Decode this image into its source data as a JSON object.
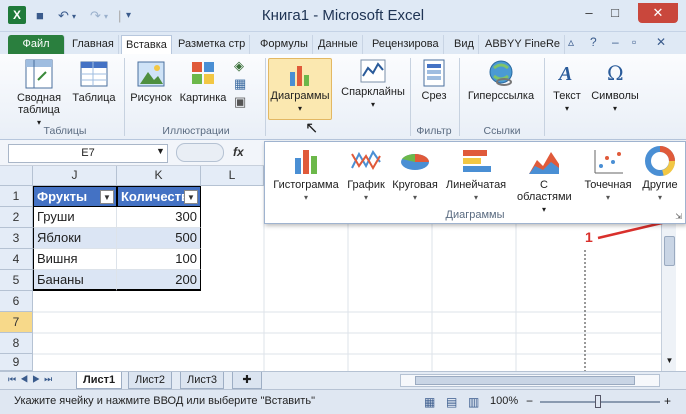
{
  "window": {
    "title": "Книга1  -  Microsoft Excel"
  },
  "tabs": [
    "Файл",
    "Главная",
    "Вставка",
    "Разметка стр",
    "Формулы",
    "Данные",
    "Рецензирова",
    "Вид",
    "ABBYY FineRe"
  ],
  "ribbon": {
    "tables": {
      "pivot": "Сводная\nтаблица",
      "pivot_arrow": "▾",
      "table": "Таблица",
      "group": "Таблицы"
    },
    "illustrations": {
      "picture": "Рисунок",
      "clipart": "Картинка",
      "group": "Иллюстрации"
    },
    "charts": {
      "label": "Диаграммы"
    },
    "sparklines": {
      "label": "Спарклайны"
    },
    "filter": {
      "slicer": "Срез",
      "group": "Фильтр"
    },
    "links": {
      "hyperlink": "Гиперссылка",
      "group": "Ссылки"
    },
    "text": {
      "label": "Текст"
    },
    "symbols": {
      "label": "Символы"
    }
  },
  "formula_bar": {
    "name_box": "E7",
    "fx": "fx"
  },
  "chart_dropdown": {
    "items": [
      "Гистограмма",
      "График",
      "Круговая",
      "Линейчатая",
      "С\nобластями",
      "Точечная",
      "Другие"
    ],
    "group": "Диаграммы",
    "annotation": "1"
  },
  "grid": {
    "col_headers": [
      "J",
      "K",
      "L"
    ],
    "row_headers": [
      "1",
      "2",
      "3",
      "4",
      "5",
      "6",
      "7",
      "8",
      "9"
    ],
    "header_row": [
      "Фрукты",
      "Количеств"
    ],
    "rows": [
      {
        "fruit": "Груши",
        "qty": "300"
      },
      {
        "fruit": "Яблоки",
        "qty": "500"
      },
      {
        "fruit": "Вишня",
        "qty": "100"
      },
      {
        "fruit": "Бананы",
        "qty": "200"
      }
    ]
  },
  "sheets": [
    "Лист1",
    "Лист2",
    "Лист3"
  ],
  "status": {
    "message": "Укажите ячейку и нажмите ВВОД или выберите \"Вставить\"",
    "zoom": "100%"
  },
  "colors": {
    "accent_green": "#2a7f3e",
    "header_fill": "#4472c4",
    "annotation_red": "#d9302c"
  }
}
